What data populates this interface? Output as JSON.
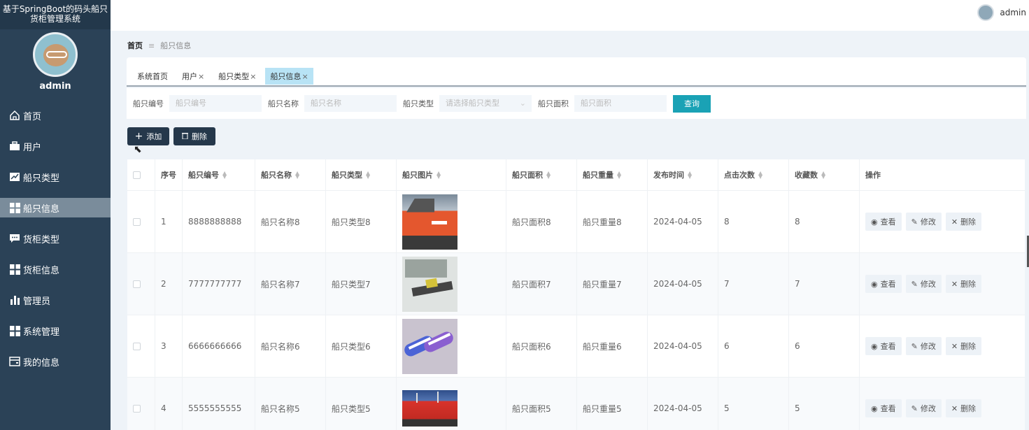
{
  "app": {
    "title": "基于SpringBoot的码头船只货柜管理系统"
  },
  "sidebar": {
    "username": "admin",
    "items": [
      {
        "label": "首页",
        "icon": "home-icon"
      },
      {
        "label": "用户",
        "icon": "briefcase-icon"
      },
      {
        "label": "船只类型",
        "icon": "line-chart-icon"
      },
      {
        "label": "船只信息",
        "icon": "grid-icon",
        "active": true
      },
      {
        "label": "货柜类型",
        "icon": "chat-icon"
      },
      {
        "label": "货柜信息",
        "icon": "grid-icon"
      },
      {
        "label": "管理员",
        "icon": "bar-chart-icon"
      },
      {
        "label": "系统管理",
        "icon": "grid-icon"
      },
      {
        "label": "我的信息",
        "icon": "wallet-icon"
      }
    ]
  },
  "topbar": {
    "username": "admin"
  },
  "breadcrumb": {
    "home": "首页",
    "current": "船只信息"
  },
  "tabs": [
    {
      "label": "系统首页",
      "closable": false
    },
    {
      "label": "用户",
      "closable": true
    },
    {
      "label": "船只类型",
      "closable": true
    },
    {
      "label": "船只信息",
      "closable": true,
      "active": true
    }
  ],
  "search": {
    "ship_no": {
      "label": "船只编号",
      "placeholder": "船只编号"
    },
    "ship_name": {
      "label": "船只名称",
      "placeholder": "船只名称"
    },
    "ship_type": {
      "label": "船只类型",
      "placeholder": "请选择船只类型"
    },
    "ship_area": {
      "label": "船只面积",
      "placeholder": "船只面积"
    },
    "query_label": "查询"
  },
  "actions": {
    "add_label": "添加",
    "delete_label": "删除"
  },
  "table": {
    "headers": [
      "序号",
      "船只编号",
      "船只名称",
      "船只类型",
      "船只图片",
      "船只面积",
      "船只重量",
      "发布时间",
      "点击次数",
      "收藏数",
      "操作"
    ],
    "rows": [
      {
        "idx": "1",
        "no": "8888888888",
        "name": "船只名称8",
        "type": "船只类型8",
        "area": "船只面积8",
        "weight": "船只重量8",
        "time": "2024-04-05",
        "clicks": "8",
        "favs": "8"
      },
      {
        "idx": "2",
        "no": "7777777777",
        "name": "船只名称7",
        "type": "船只类型7",
        "area": "船只面积7",
        "weight": "船只重量7",
        "time": "2024-04-05",
        "clicks": "7",
        "favs": "7"
      },
      {
        "idx": "3",
        "no": "6666666666",
        "name": "船只名称6",
        "type": "船只类型6",
        "area": "船只面积6",
        "weight": "船只重量6",
        "time": "2024-04-05",
        "clicks": "6",
        "favs": "6"
      },
      {
        "idx": "4",
        "no": "5555555555",
        "name": "船只名称5",
        "type": "船只类型5",
        "area": "船只面积5",
        "weight": "船只重量5",
        "time": "2024-04-05",
        "clicks": "5",
        "favs": "5"
      }
    ],
    "ops": {
      "view": "查看",
      "edit": "修改",
      "delete": "删除"
    }
  }
}
